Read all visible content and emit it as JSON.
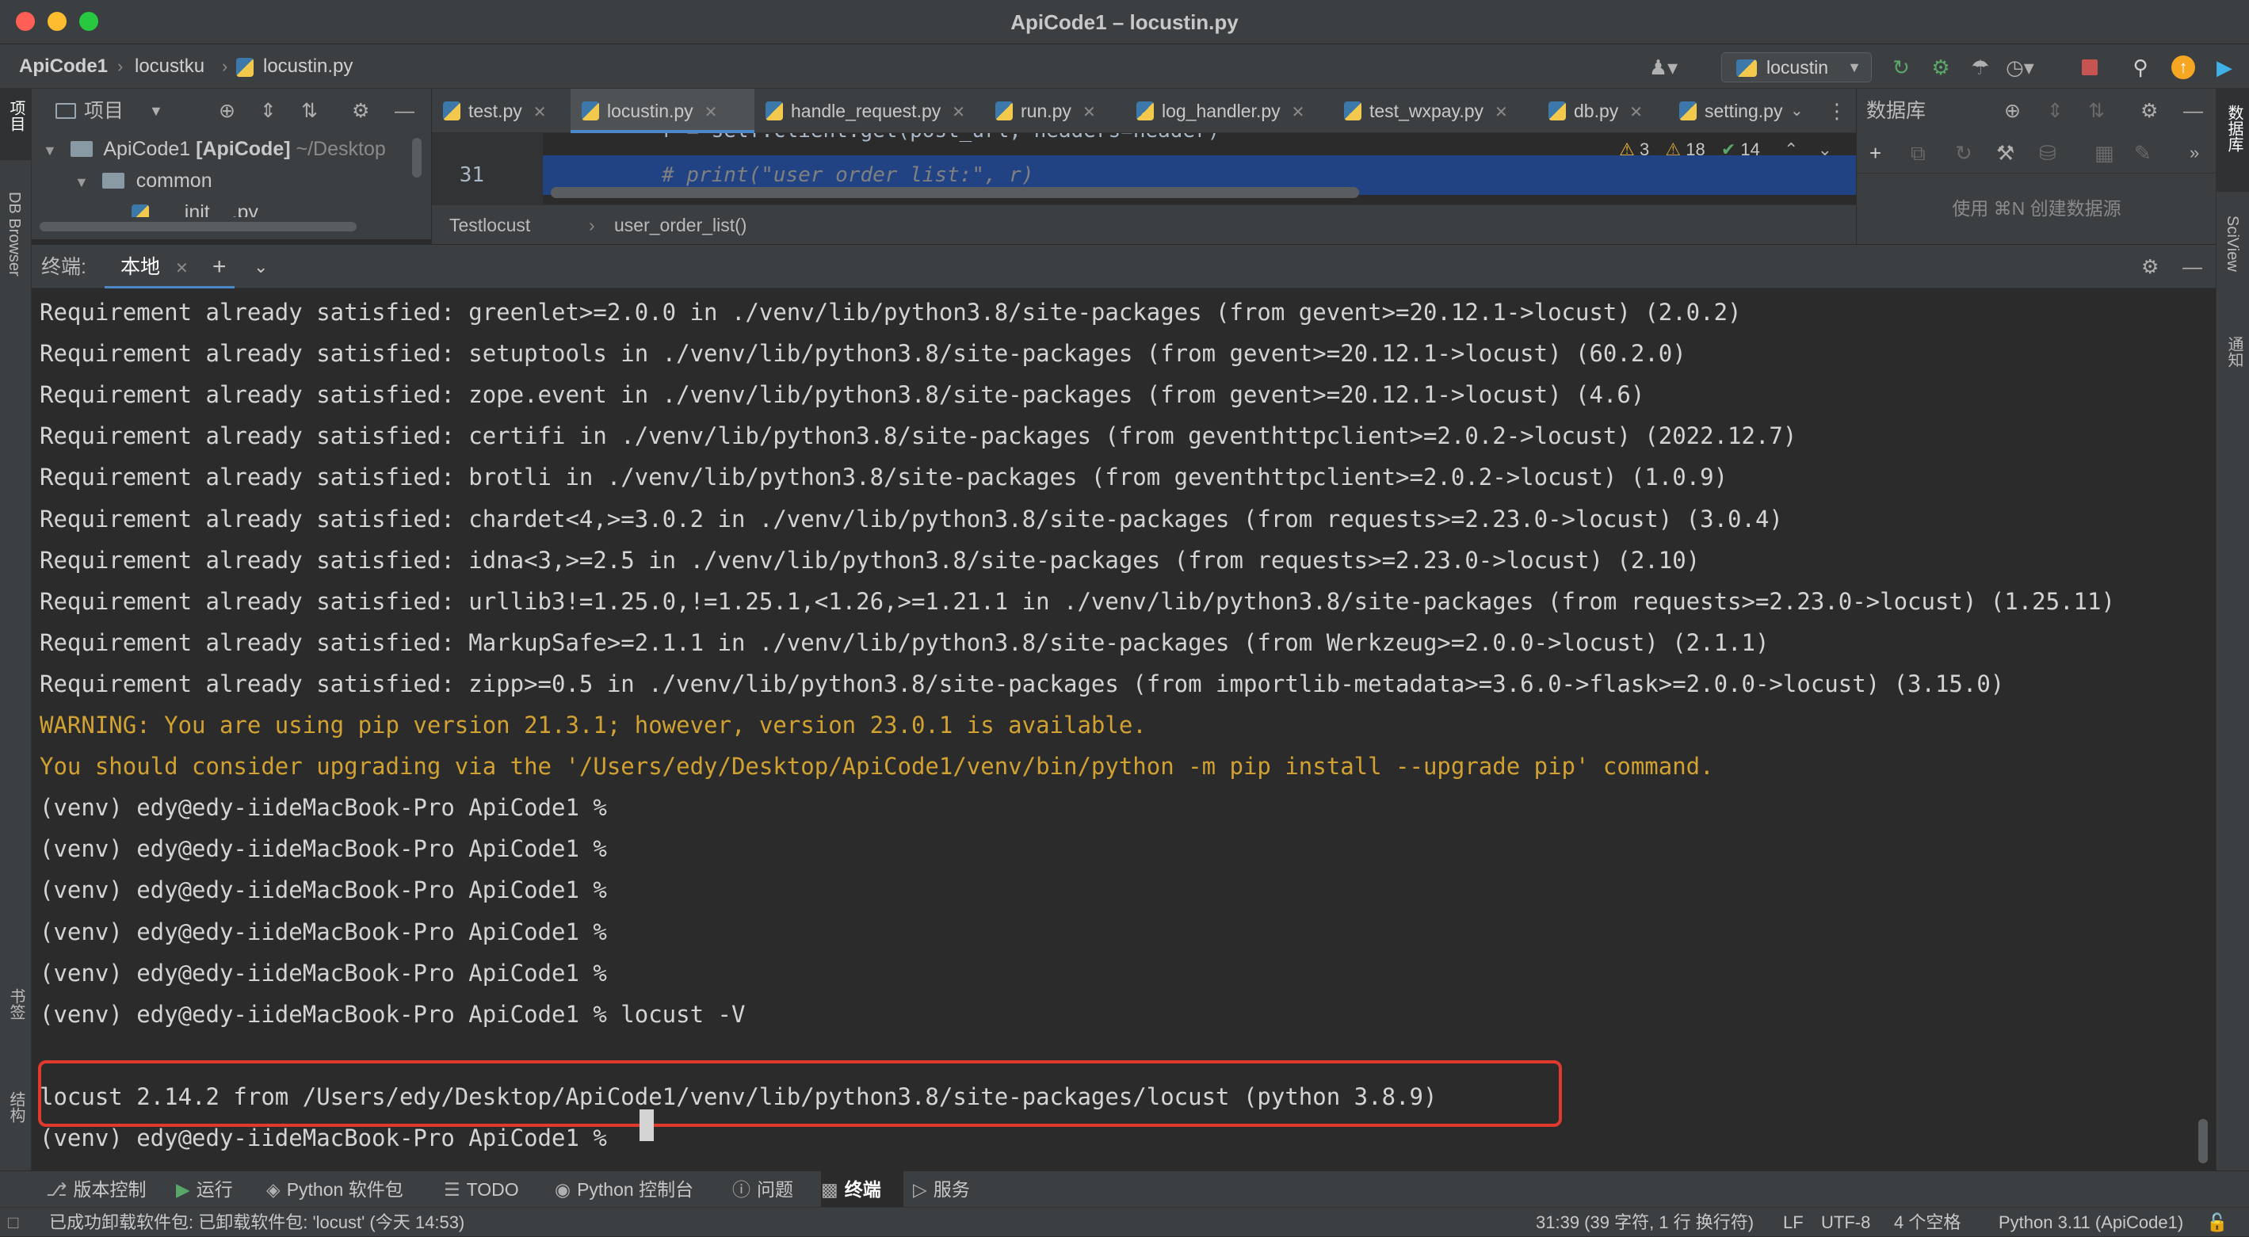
{
  "window": {
    "title": "ApiCode1 – locustin.py"
  },
  "colors": {
    "background": "#2b2b2b",
    "panel": "#3c3f41",
    "selection": "#214283",
    "accent": "#4a88c7",
    "warning_text": "#d1a132",
    "highlight_box": "#e0392d"
  },
  "navbar": {
    "breadcrumbs": [
      "ApiCode1",
      "locustku",
      "locustin.py"
    ],
    "run_config": "locustin"
  },
  "left_stripe": {
    "top_labels": [
      "项目",
      "DB Browser"
    ],
    "bottom_labels": [
      "书签",
      "结构"
    ]
  },
  "right_stripe": {
    "labels": [
      "数据库",
      "SciView",
      "通知"
    ]
  },
  "project_panel": {
    "title": "项目",
    "tree": [
      {
        "label": "ApiCode1",
        "module": "[ApiCode]",
        "path": "~/Desktop"
      },
      {
        "label": "common"
      },
      {
        "label": "__init__.py"
      }
    ]
  },
  "editor": {
    "tabs": [
      "test.py",
      "locustin.py",
      "handle_request.py",
      "run.py",
      "log_handler.py",
      "test_wxpay.py",
      "db.py",
      "setting.py"
    ],
    "active_tab": "locustin.py",
    "partial_line": "r = self.client.get(post_url, headers=header)",
    "line_number": "31",
    "code_line": "# print(\"user order list:\", r)",
    "inspections": {
      "warnings": "3",
      "weak_warnings": "18",
      "ok": "14"
    },
    "breadcrumb": [
      "Testlocust",
      "user_order_list()"
    ]
  },
  "database_panel": {
    "title": "数据库",
    "hint": "使用 ⌘N 创建数据源"
  },
  "terminal": {
    "label": "终端:",
    "tab": "本地",
    "lines": [
      {
        "text": "Requirement already satisfied: greenlet>=2.0.0 in ./venv/lib/python3.8/site-packages (from gevent>=20.12.1->locust) (2.0.2)",
        "type": "normal"
      },
      {
        "text": "Requirement already satisfied: setuptools in ./venv/lib/python3.8/site-packages (from gevent>=20.12.1->locust) (60.2.0)",
        "type": "normal"
      },
      {
        "text": "Requirement already satisfied: zope.event in ./venv/lib/python3.8/site-packages (from gevent>=20.12.1->locust) (4.6)",
        "type": "normal"
      },
      {
        "text": "Requirement already satisfied: certifi in ./venv/lib/python3.8/site-packages (from geventhttpclient>=2.0.2->locust) (2022.12.7)",
        "type": "normal"
      },
      {
        "text": "Requirement already satisfied: brotli in ./venv/lib/python3.8/site-packages (from geventhttpclient>=2.0.2->locust) (1.0.9)",
        "type": "normal"
      },
      {
        "text": "Requirement already satisfied: chardet<4,>=3.0.2 in ./venv/lib/python3.8/site-packages (from requests>=2.23.0->locust) (3.0.4)",
        "type": "normal"
      },
      {
        "text": "Requirement already satisfied: idna<3,>=2.5 in ./venv/lib/python3.8/site-packages (from requests>=2.23.0->locust) (2.10)",
        "type": "normal"
      },
      {
        "text": "Requirement already satisfied: urllib3!=1.25.0,!=1.25.1,<1.26,>=1.21.1 in ./venv/lib/python3.8/site-packages (from requests>=2.23.0->locust) (1.25.11)",
        "type": "normal"
      },
      {
        "text": "Requirement already satisfied: MarkupSafe>=2.1.1 in ./venv/lib/python3.8/site-packages (from Werkzeug>=2.0.0->locust) (2.1.1)",
        "type": "normal"
      },
      {
        "text": "Requirement already satisfied: zipp>=0.5 in ./venv/lib/python3.8/site-packages (from importlib-metadata>=3.6.0->flask>=2.0.0->locust) (3.15.0)",
        "type": "normal"
      },
      {
        "text": "WARNING: You are using pip version 21.3.1; however, version 23.0.1 is available.",
        "type": "warn"
      },
      {
        "text": "You should consider upgrading via the '/Users/edy/Desktop/ApiCode1/venv/bin/python -m pip install --upgrade pip' command.",
        "type": "warn"
      },
      {
        "text": "(venv) edy@edy-iideMacBook-Pro ApiCode1 %",
        "type": "normal"
      },
      {
        "text": "(venv) edy@edy-iideMacBook-Pro ApiCode1 %",
        "type": "normal"
      },
      {
        "text": "(venv) edy@edy-iideMacBook-Pro ApiCode1 %",
        "type": "normal"
      },
      {
        "text": "(venv) edy@edy-iideMacBook-Pro ApiCode1 %",
        "type": "normal"
      },
      {
        "text": "(venv) edy@edy-iideMacBook-Pro ApiCode1 %",
        "type": "normal"
      },
      {
        "text": "(venv) edy@edy-iideMacBook-Pro ApiCode1 % locust -V",
        "type": "normal"
      },
      {
        "text": "",
        "type": "normal"
      },
      {
        "text": "locust 2.14.2 from /Users/edy/Desktop/ApiCode1/venv/lib/python3.8/site-packages/locust (python 3.8.9)",
        "type": "highlight"
      },
      {
        "text": "(venv) edy@edy-iideMacBook-Pro ApiCode1 %",
        "type": "prompt"
      }
    ]
  },
  "tool_windows": [
    {
      "label": "版本控制",
      "icon": "branch-icon"
    },
    {
      "label": "运行",
      "icon": "run-icon"
    },
    {
      "label": "Python 软件包",
      "icon": "layers-icon"
    },
    {
      "label": "TODO",
      "icon": "list-icon"
    },
    {
      "label": "Python 控制台",
      "icon": "python-icon"
    },
    {
      "label": "问题",
      "icon": "info-icon"
    },
    {
      "label": "终端",
      "icon": "terminal-icon",
      "active": true
    },
    {
      "label": "服务",
      "icon": "services-icon"
    }
  ],
  "status_bar": {
    "message": "已成功卸载软件包: 已卸载软件包: 'locust' (今天 14:53)",
    "position": "31:39 (39 字符, 1 行 换行符)",
    "line_sep": "LF",
    "encoding": "UTF-8",
    "indent": "4 个空格",
    "interpreter": "Python 3.11 (ApiCode1)"
  }
}
